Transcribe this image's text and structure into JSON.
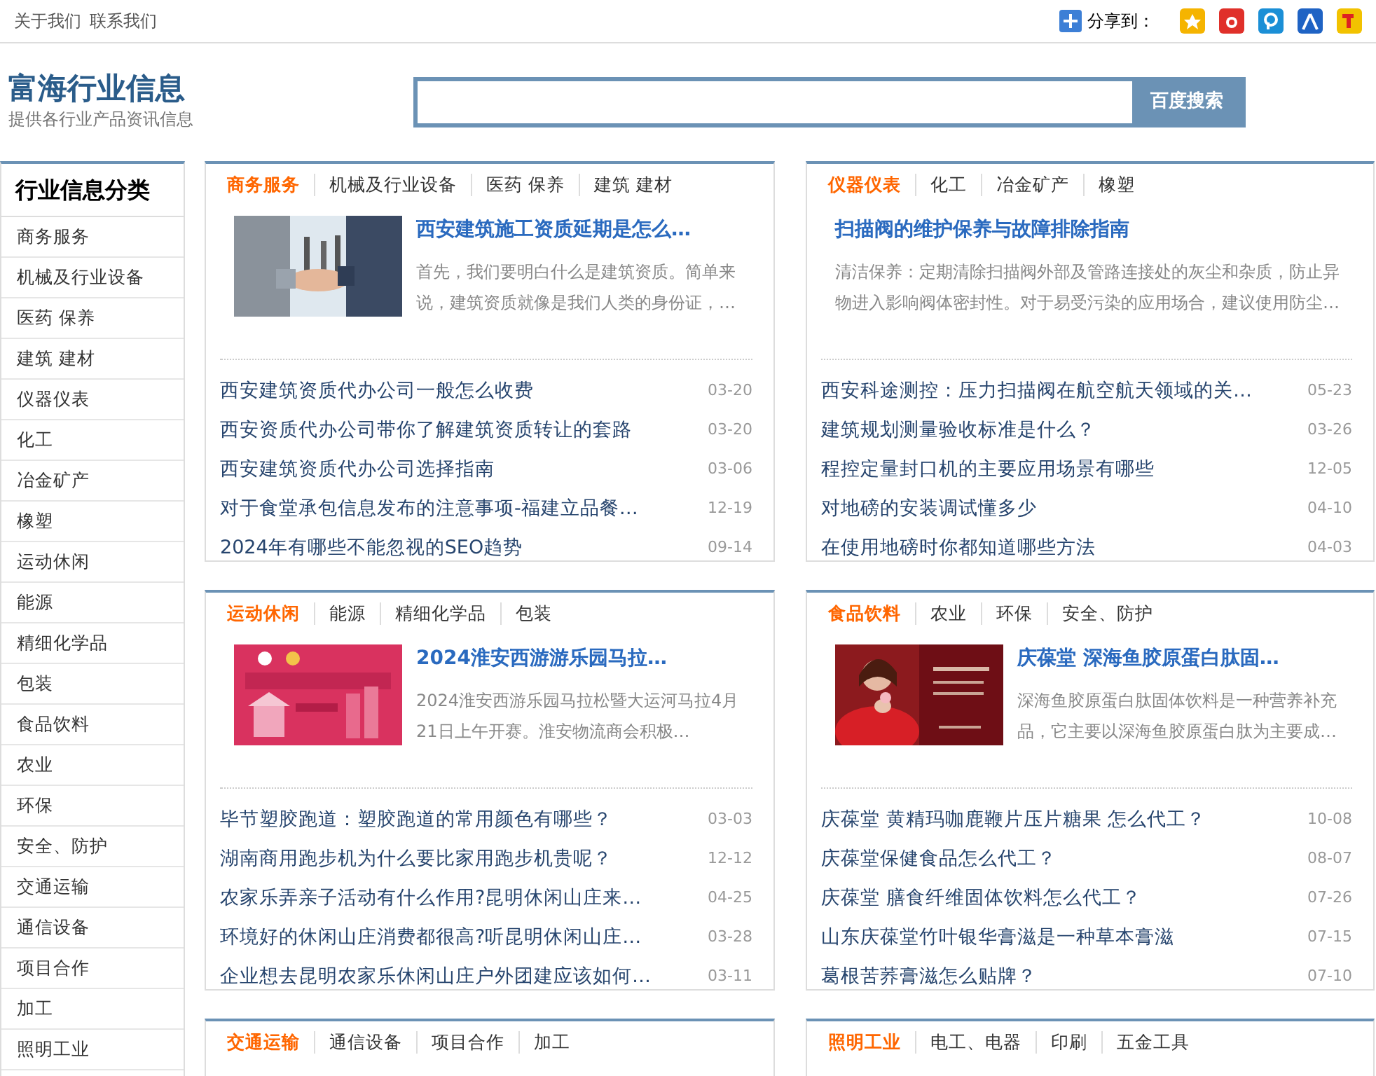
{
  "top_links": [
    "关于我们",
    "联系我们"
  ],
  "share": {
    "label": "分享到："
  },
  "site": {
    "title": "富海行业信息",
    "subtitle": "提供各行业产品资讯信息"
  },
  "search": {
    "button": "百度搜索"
  },
  "sidebar": {
    "title": "行业信息分类",
    "items": [
      "商务服务",
      "机械及行业设备",
      "医药 保养",
      "建筑 建材",
      "仪器仪表",
      "化工",
      "冶金矿产",
      "橡塑",
      "运动休闲",
      "能源",
      "精细化学品",
      "包装",
      "食品饮料",
      "农业",
      "环保",
      "安全、防护",
      "交通运输",
      "通信设备",
      "项目合作",
      "加工",
      "照明工业"
    ]
  },
  "panels": [
    {
      "tabs": [
        {
          "label": "商务服务",
          "selected": true
        },
        {
          "label": "机械及行业设备",
          "selected": false
        },
        {
          "label": "医药 保养",
          "selected": false
        },
        {
          "label": "建筑 建材",
          "selected": false
        }
      ],
      "feature": {
        "kind": "picture",
        "title": "西安建筑施工资质延期是怎么…",
        "summary": "首先，我们要明白什么是建筑资质。简单来说，建筑资质就像是我们人类的身份证，…"
      },
      "items": [
        {
          "title": "西安建筑资质代办公司一般怎么收费",
          "date": "03-20"
        },
        {
          "title": "西安资质代办公司带你了解建筑资质转让的套路",
          "date": "03-20"
        },
        {
          "title": "西安建筑资质代办公司选择指南",
          "date": "03-06"
        },
        {
          "title": "对于食堂承包信息发布的注意事项-福建立品餐…",
          "date": "12-19"
        },
        {
          "title": "2024年有哪些不能忽视的SEO趋势",
          "date": "09-14"
        }
      ]
    },
    {
      "tabs": [
        {
          "label": "仪器仪表",
          "selected": true
        },
        {
          "label": "化工",
          "selected": false
        },
        {
          "label": "冶金矿产",
          "selected": false
        },
        {
          "label": "橡塑",
          "selected": false
        }
      ],
      "feature": {
        "kind": "text",
        "title": "扫描阀的维护保养与故障排除指南",
        "summary": "清洁保养：定期清除扫描阀外部及管路连接处的灰尘和杂质，防止异物进入影响阀体密封性。对于易受污染的应用场合，建议使用防尘…"
      },
      "items": [
        {
          "title": "西安科途测控：压力扫描阀在航空航天领域的关…",
          "date": "05-23"
        },
        {
          "title": "建筑规划测量验收标准是什么？",
          "date": "03-26"
        },
        {
          "title": "程控定量封口机的主要应用场景有哪些",
          "date": "12-05"
        },
        {
          "title": "对地磅的安装调试懂多少",
          "date": "04-10"
        },
        {
          "title": "在使用地磅时你都知道哪些方法",
          "date": "04-03"
        }
      ]
    },
    {
      "tabs": [
        {
          "label": "运动休闲",
          "selected": true
        },
        {
          "label": "能源",
          "selected": false
        },
        {
          "label": "精细化学品",
          "selected": false
        },
        {
          "label": "包装",
          "selected": false
        }
      ],
      "feature": {
        "kind": "picture",
        "title": "2024淮安西游游乐园马拉…",
        "summary": "2024淮安西游乐园马拉松暨大运河马拉4月21日上午开赛。淮安物流商会积极…"
      },
      "items": [
        {
          "title": "毕节塑胶跑道：塑胶跑道的常用颜色有哪些？",
          "date": "03-03"
        },
        {
          "title": "湖南商用跑步机为什么要比家用跑步机贵呢？",
          "date": "12-12"
        },
        {
          "title": "农家乐弄亲子活动有什么作用?昆明休闲山庄来…",
          "date": "04-25"
        },
        {
          "title": "环境好的休闲山庄消费都很高?听昆明休闲山庄…",
          "date": "03-28"
        },
        {
          "title": "企业想去昆明农家乐休闲山庄户外团建应该如何…",
          "date": "03-11"
        }
      ]
    },
    {
      "tabs": [
        {
          "label": "食品饮料",
          "selected": true
        },
        {
          "label": "农业",
          "selected": false
        },
        {
          "label": "环保",
          "selected": false
        },
        {
          "label": "安全、防护",
          "selected": false
        }
      ],
      "feature": {
        "kind": "picture",
        "title": "庆葆堂 深海鱼胶原蛋白肽固…",
        "summary": "深海鱼胶原蛋白肽固体饮料是一种营养补充品，它主要以深海鱼胶原蛋白肽为主要成…"
      },
      "items": [
        {
          "title": "庆葆堂 黄精玛咖鹿鞭片压片糖果 怎么代工？",
          "date": "10-08"
        },
        {
          "title": "庆葆堂保健食品怎么代工？",
          "date": "08-07"
        },
        {
          "title": "庆葆堂 膳食纤维固体饮料怎么代工？",
          "date": "07-26"
        },
        {
          "title": "山东庆葆堂竹叶银华膏滋是一种草本膏滋",
          "date": "07-15"
        },
        {
          "title": "葛根苦荞膏滋怎么贴牌？",
          "date": "07-10"
        }
      ]
    },
    {
      "tabs": [
        {
          "label": "交通运输",
          "selected": true
        },
        {
          "label": "通信设备",
          "selected": false
        },
        {
          "label": "项目合作",
          "selected": false
        },
        {
          "label": "加工",
          "selected": false
        }
      ]
    },
    {
      "tabs": [
        {
          "label": "照明工业",
          "selected": true
        },
        {
          "label": "电工、电器",
          "selected": false
        },
        {
          "label": "印刷",
          "selected": false
        },
        {
          "label": "五金工具",
          "selected": false
        }
      ]
    }
  ]
}
